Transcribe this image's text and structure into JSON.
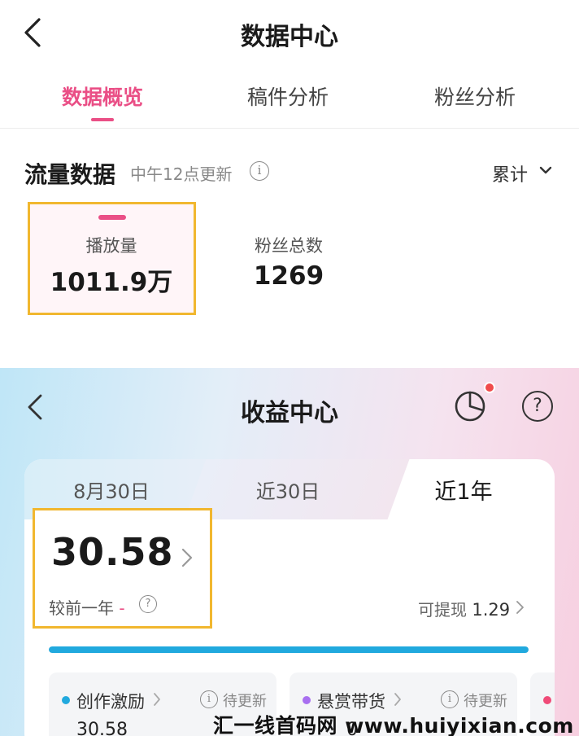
{
  "data_center": {
    "title": "数据中心",
    "tabs": [
      {
        "label": "数据概览",
        "active": true
      },
      {
        "label": "稿件分析",
        "active": false
      },
      {
        "label": "粉丝分析",
        "active": false
      }
    ],
    "flow": {
      "title": "流量数据",
      "update_note": "中午12点更新",
      "period": "累计",
      "metrics": [
        {
          "label": "播放量",
          "value": "1011.9万",
          "highlighted": true
        },
        {
          "label": "粉丝总数",
          "value": "1269",
          "highlighted": false
        }
      ]
    }
  },
  "income_center": {
    "title": "收益中心",
    "has_notification": true,
    "tabs": [
      {
        "label": "8月30日",
        "active": false
      },
      {
        "label": "近30日",
        "active": false
      },
      {
        "label": "近1年",
        "active": true
      }
    ],
    "total": "30.58",
    "compare_label": "较前一年",
    "compare_value": "-",
    "withdraw_label": "可提现",
    "withdraw_value": "1.29",
    "progress_fraction": 1.0,
    "categories": [
      {
        "name": "创作激励",
        "status": "待更新",
        "value": "30.58",
        "dot_color": "#21a9de"
      },
      {
        "name": "悬赏带货",
        "status": "待更新",
        "value": "0",
        "dot_color": "#a86ff0"
      },
      {
        "name": "",
        "status": "",
        "value": "",
        "dot_color": "#f04b78"
      }
    ]
  },
  "watermark": "汇一线首码网 www.huiyixian.com",
  "colors": {
    "accent_pink": "#ea4f86",
    "highlight_border": "#f1b72f",
    "progress_blue": "#21a9de"
  }
}
